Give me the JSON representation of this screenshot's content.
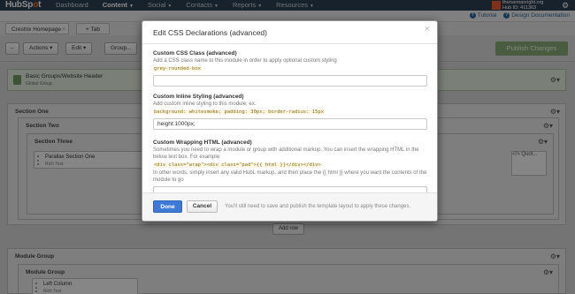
{
  "topnav": {
    "logo_a": "HubSp",
    "logo_dot": "o",
    "logo_b": "t",
    "items": [
      {
        "label": "Dashboard"
      },
      {
        "label": "Content"
      },
      {
        "label": "Social"
      },
      {
        "label": "Contacts"
      },
      {
        "label": "Reports"
      },
      {
        "label": "Resources"
      }
    ],
    "account_line1": "theruemanright.org",
    "account_line2": "Hub ID: 411363"
  },
  "subbar": {
    "tutorial": "Tutorial",
    "design_docs": "Design Documentation",
    "help_icon": "?"
  },
  "tabs": {
    "page_tab": "Crestrix Homepage",
    "close": "×",
    "add_tab": "+ Tab"
  },
  "toolbar": {
    "back": "←",
    "actions": "Actions",
    "edit": "Edit",
    "group": "Group...",
    "publish": "Publish Changes",
    "caret": "▾"
  },
  "layout": {
    "global_title": "Basic Groups/Website Header",
    "global_sub": "Global Group",
    "section_one": "Section One",
    "section_two": "Section Two",
    "section_three": "Section Three",
    "parallax_title": "Parallax Section One",
    "parallax_sub": "Rich Text",
    "html_card_prefix": "</>",
    "html_card_text": "Quot...",
    "add_row": "Add row",
    "module_group": "Module Group",
    "module_group_inner": "Module Group",
    "left_column": "Left Column",
    "left_column_sub": "Rich Text",
    "gear_glyph": "⚙▾"
  },
  "modal": {
    "title": "Edit CSS Declarations (advanced)",
    "close": "×",
    "css_class": {
      "label": "Custom CSS Class (advanced)",
      "hint": "Add a CSS class name to this module in order to apply optional custom styling",
      "example": "grey-rounded-box",
      "value": ""
    },
    "inline_style": {
      "label": "Custom Inline Styling (advanced)",
      "hint": "Add custom inline styling to this module, ex.",
      "example": "background: whitesmoke; padding: 30px; border-radius: 15px",
      "value": "height:1000px;"
    },
    "wrapping_html": {
      "label": "Custom Wrapping HTML (advanced)",
      "hint1": "Sometimes you need to wrap a module or group with additional markup. You can insert the wrapping HTML in the below text box. For example:",
      "example": "<div class=\"wrap\"><div class=\"pad\">{{ html }}</div></div>",
      "hint2": "In other words, simply insert any valid HubL markup, and then place the {{ html }} where you want the contents of the module to go"
    },
    "done": "Done",
    "cancel": "Cancel",
    "footer_note": "You'll still need to save and publish the template layout to apply these changes."
  }
}
